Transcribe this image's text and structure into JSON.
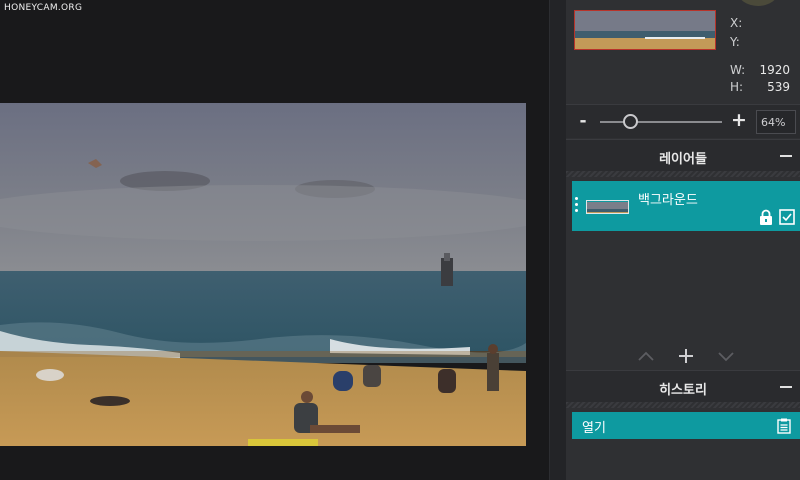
{
  "watermark": "HONEYCAM.ORG",
  "navigator": {
    "x_label": "X:",
    "y_label": "Y:",
    "w_label": "W:",
    "h_label": "H:",
    "w_value": "1920",
    "h_value": "539"
  },
  "zoom": {
    "minus_label": "-",
    "plus_label": "+",
    "value": "64%",
    "level_fraction": 0.25
  },
  "layers": {
    "title": "레이어들",
    "items": [
      {
        "name": "백그라운드"
      }
    ],
    "icons": [
      "lock-icon",
      "visibility-check-icon",
      "move-up-icon",
      "add-icon",
      "move-down-icon"
    ]
  },
  "history": {
    "title": "히스토리",
    "items": [
      {
        "label": "열기"
      }
    ],
    "icons": [
      "document-icon"
    ]
  },
  "colors": {
    "accent": "#0e9aa0",
    "panel": "#2f3033",
    "background": "#19191b"
  }
}
